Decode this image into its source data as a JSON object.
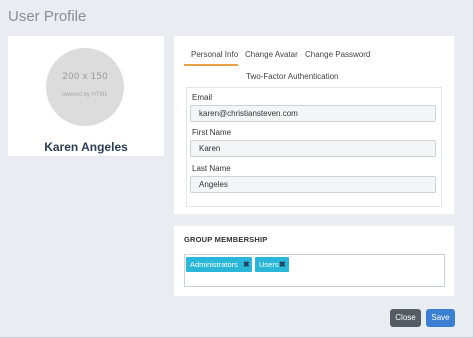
{
  "window": {
    "title": "User Profile"
  },
  "profile": {
    "avatar_placeholder": "200 x 150",
    "avatar_caption": "owered by HTML",
    "name": "Karen Angeles"
  },
  "tabs": [
    {
      "label": "Personal Info",
      "active": true
    },
    {
      "label": "Change Avatar",
      "active": false
    },
    {
      "label": "Change Password",
      "active": false
    },
    {
      "label": "Two-Factor Authentication",
      "active": false
    }
  ],
  "form": {
    "email_label": "Email",
    "email_value": "karen@christiansteven.com",
    "first_name_label": "First Name",
    "first_name_value": "Karen",
    "last_name_label": "Last Name",
    "last_name_value": "Angeles"
  },
  "groups": {
    "title": "GROUP MEMBERSHIP",
    "tags": [
      {
        "label": "Administrators",
        "remove_icon": "close-icon"
      },
      {
        "label": "Users",
        "remove_icon": "close-icon"
      }
    ]
  },
  "actions": {
    "close_label": "Close",
    "save_label": "Save"
  },
  "colors": {
    "accent_tab": "#e6a14a",
    "tag_bg": "#29b6d8",
    "save_button": "#3a7fd2",
    "close_button": "#555c63"
  }
}
